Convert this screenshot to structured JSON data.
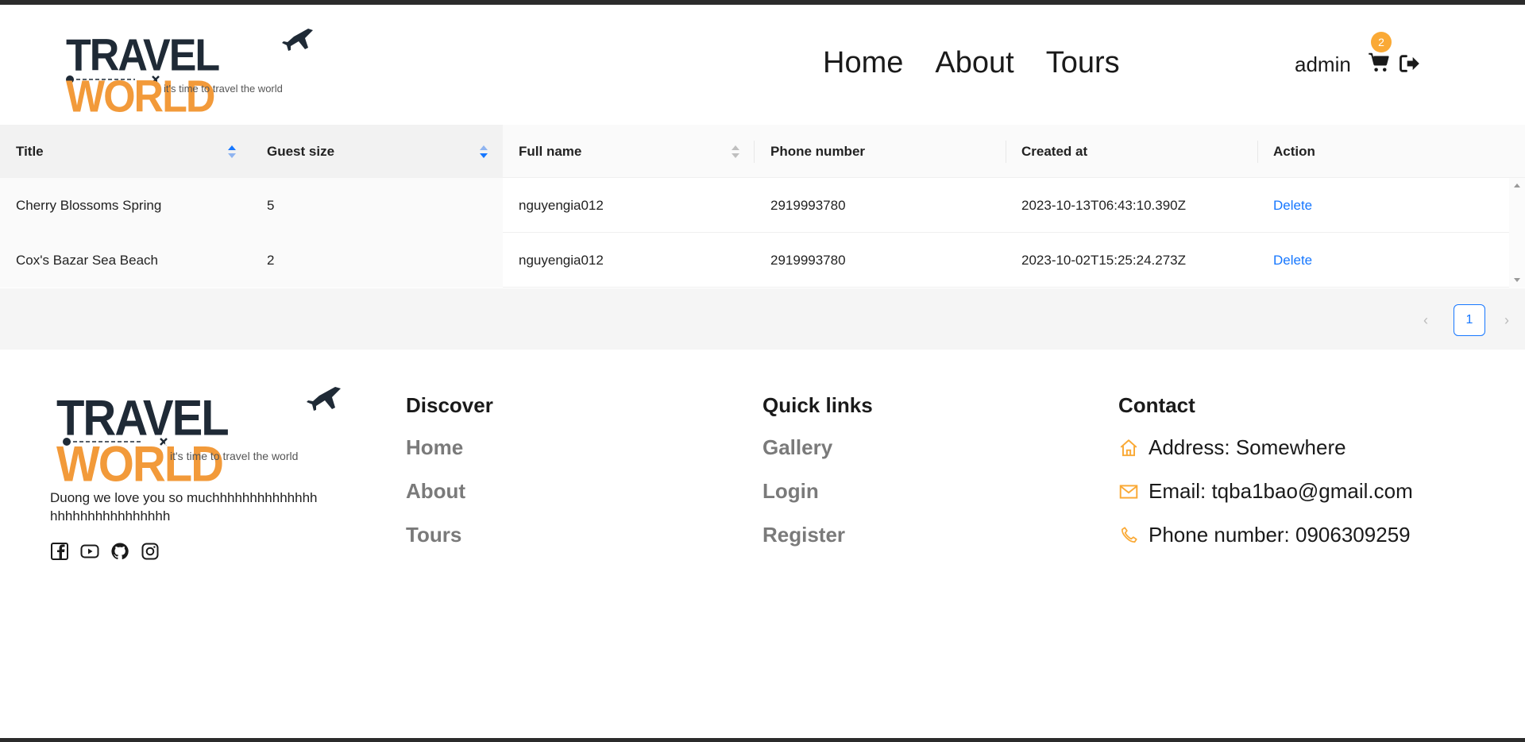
{
  "header": {
    "logo": {
      "word1": "TRAVEL",
      "word2": "WORLD",
      "tagline": "it's time to travel the world"
    },
    "nav": [
      "Home",
      "About",
      "Tours"
    ],
    "username": "admin",
    "cart_count": "2",
    "icons": {
      "cart": "cart-icon",
      "logout": "logout-icon"
    }
  },
  "table": {
    "columns": [
      "Title",
      "Guest size",
      "Full name",
      "Phone number",
      "Created at",
      "Action"
    ],
    "rows": [
      [
        "Cherry Blossoms Spring",
        "5",
        "nguyengia012",
        "2919993780",
        "2023-10-13T06:43:10.390Z",
        "Delete"
      ],
      [
        "Cox's Bazar Sea Beach",
        "2",
        "nguyengia012",
        "2919993780",
        "2023-10-02T15:25:24.273Z",
        "Delete"
      ]
    ],
    "pagination": {
      "current": "1",
      "prev": "‹",
      "next": "›"
    }
  },
  "footer": {
    "logo": {
      "word1": "TRAVEL",
      "word2": "WORLD",
      "tagline": "it's time to travel the world"
    },
    "description": "Duong we love you so muchhhhhhhhhhhhhhhhhhhhhhhhhhhhhh",
    "social": [
      "facebook-icon",
      "youtube-icon",
      "github-icon",
      "instagram-icon"
    ],
    "discover": {
      "title": "Discover",
      "links": [
        "Home",
        "About",
        "Tours"
      ]
    },
    "quick_links": {
      "title": "Quick links",
      "links": [
        "Gallery",
        "Login",
        "Register"
      ]
    },
    "contact": {
      "title": "Contact",
      "address": "Address: Somewhere",
      "email": "Email: tqba1bao@gmail.com",
      "phone": "Phone number: 0906309259"
    }
  },
  "colors": {
    "accent": "#f29a3a",
    "link": "#1677ff",
    "dark": "#1f2a36",
    "badge": "#faa935"
  }
}
